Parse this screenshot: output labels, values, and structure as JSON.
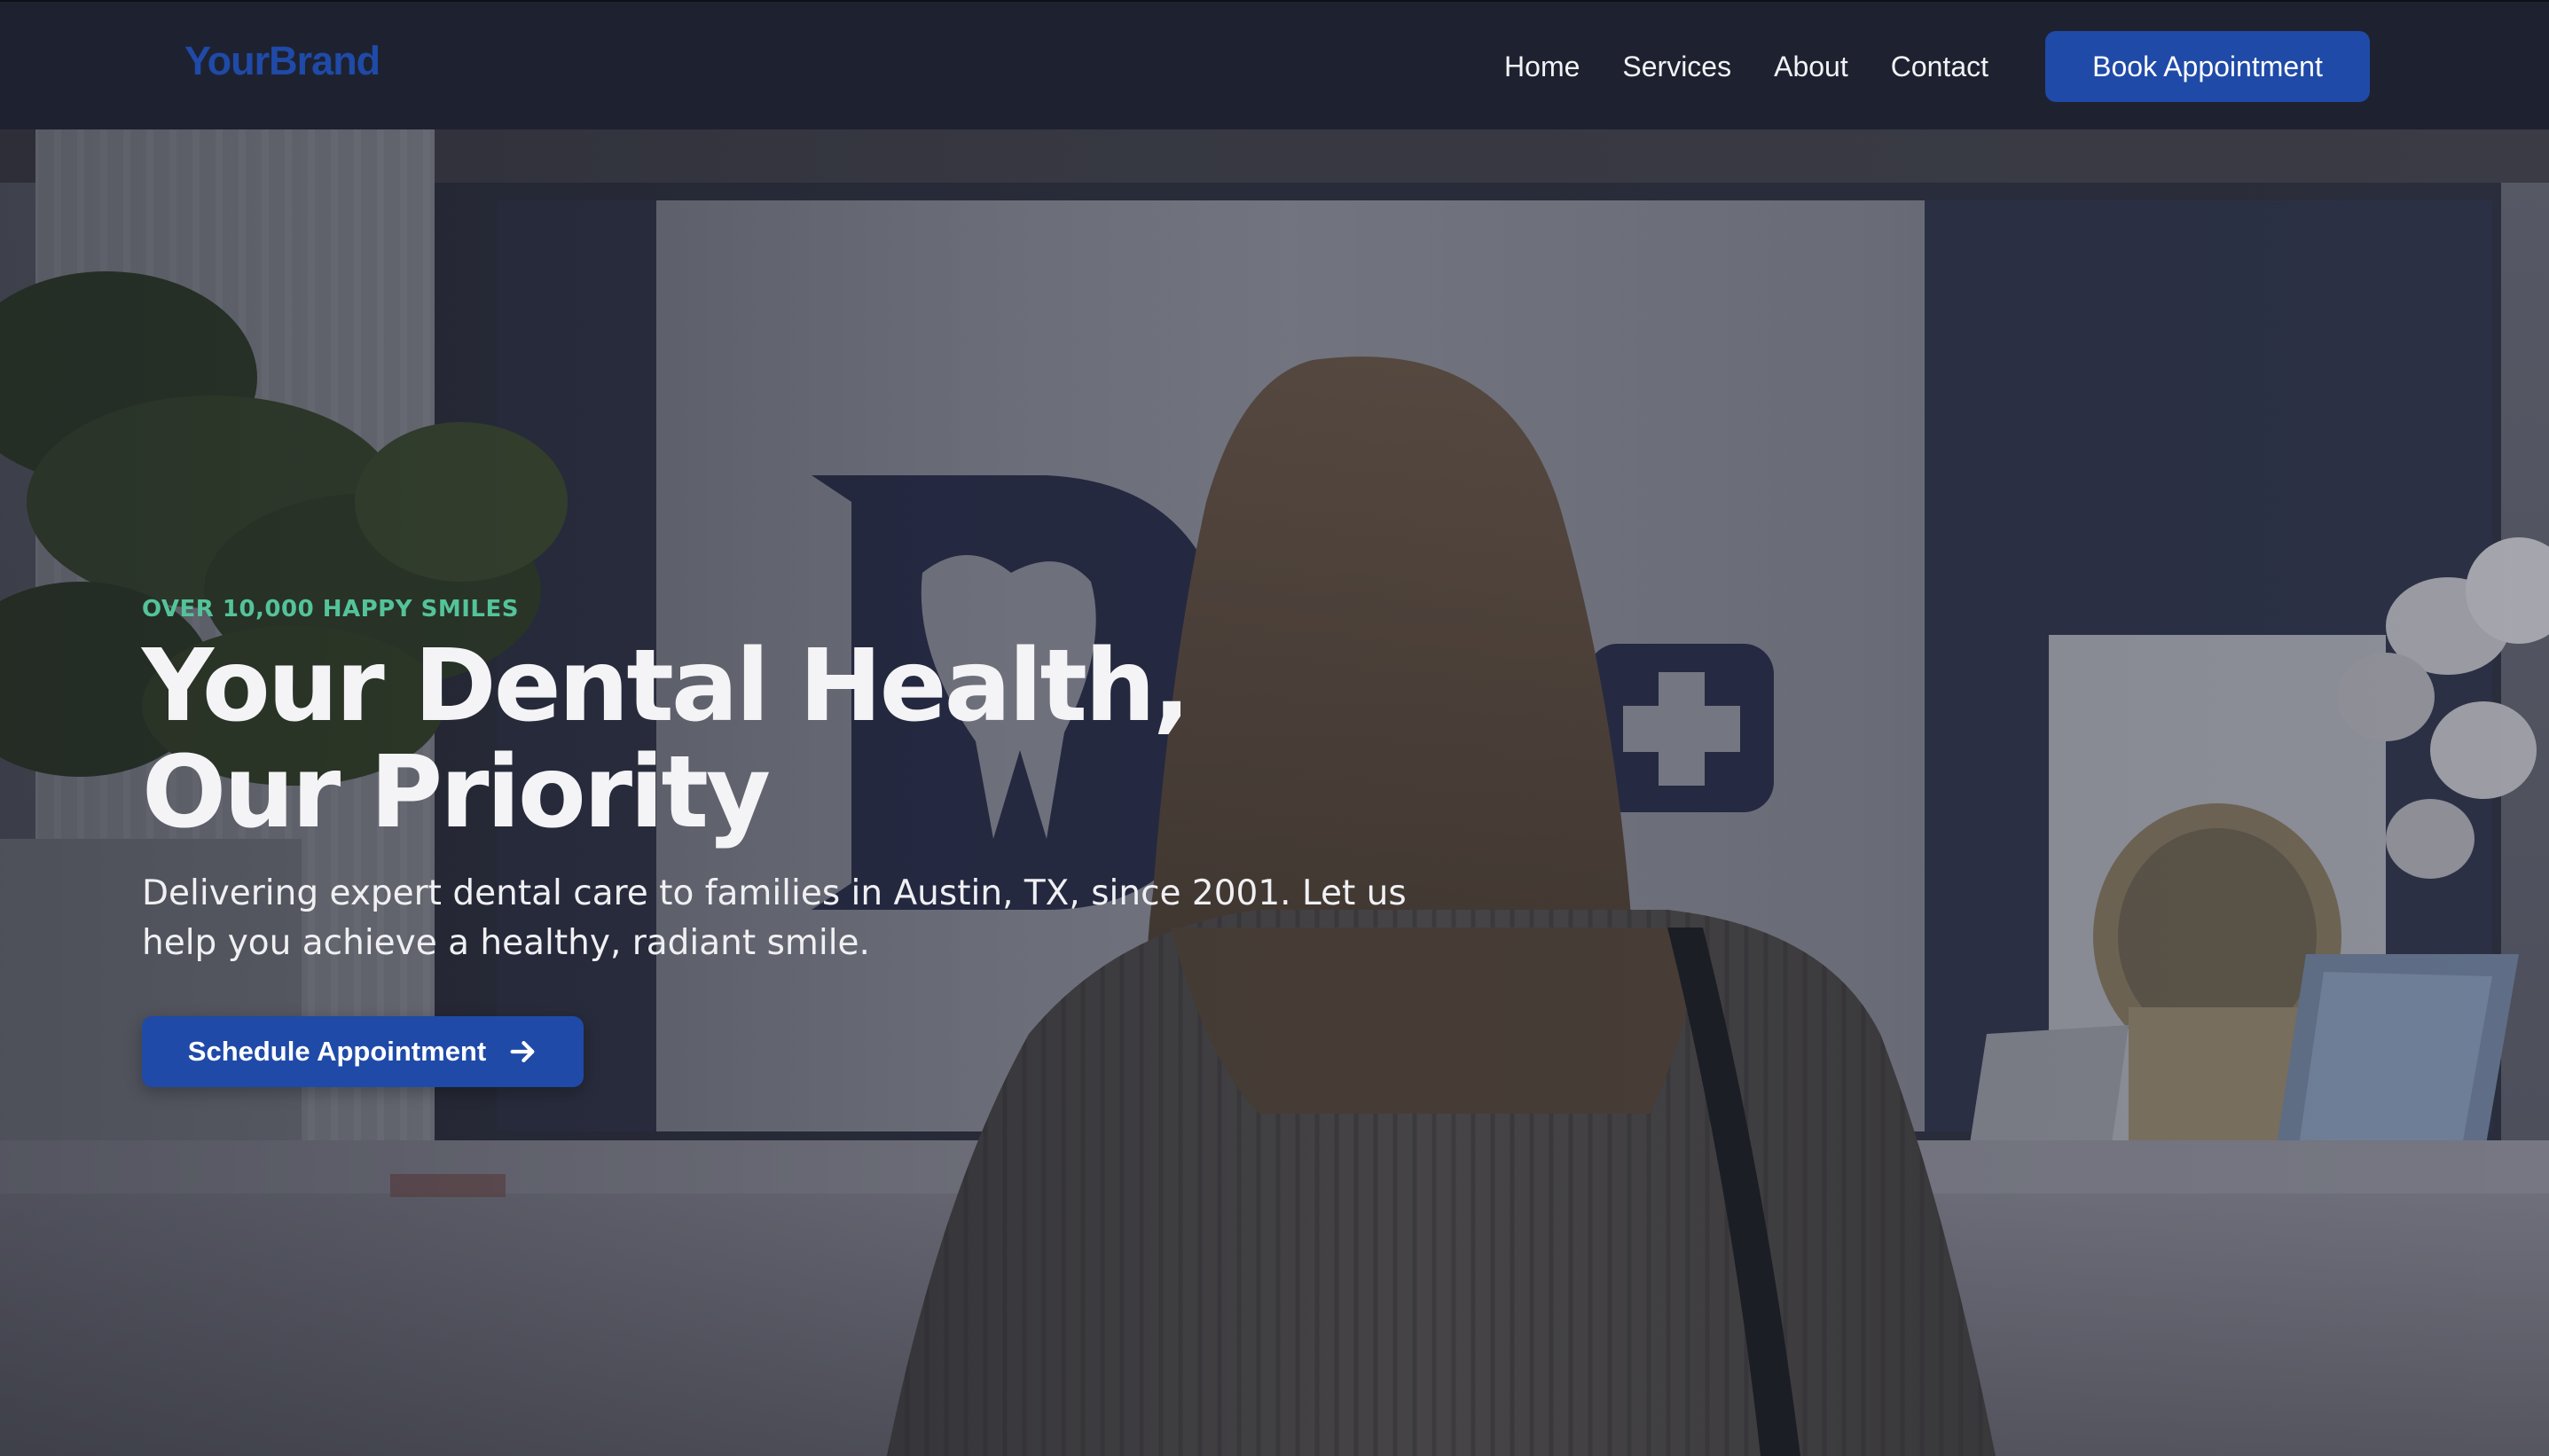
{
  "navbar": {
    "brand": "YourBrand",
    "links": [
      {
        "label": "Home"
      },
      {
        "label": "Services"
      },
      {
        "label": "About"
      },
      {
        "label": "Contact"
      }
    ],
    "cta_label": "Book Appointment"
  },
  "hero": {
    "eyebrow": "OVER 10,000 HAPPY SMILES",
    "headline_line1": "Your Dental Health,",
    "headline_line2": "Our Priority",
    "subtext_line1": "Delivering expert dental care to families in Austin, TX, since 2001. Let us",
    "subtext_line2": "help you achieve a healthy, radiant smile.",
    "cta_label": "Schedule Appointment",
    "cta_icon": "arrow-right-icon",
    "background_image": "reception-desk-photo"
  },
  "colors": {
    "nav_background": "#1e2230",
    "brand": "#1f4aa8",
    "primary_button": "#1f4aa8",
    "accent_green": "#54c39a",
    "text_light": "#f4f4f6"
  }
}
